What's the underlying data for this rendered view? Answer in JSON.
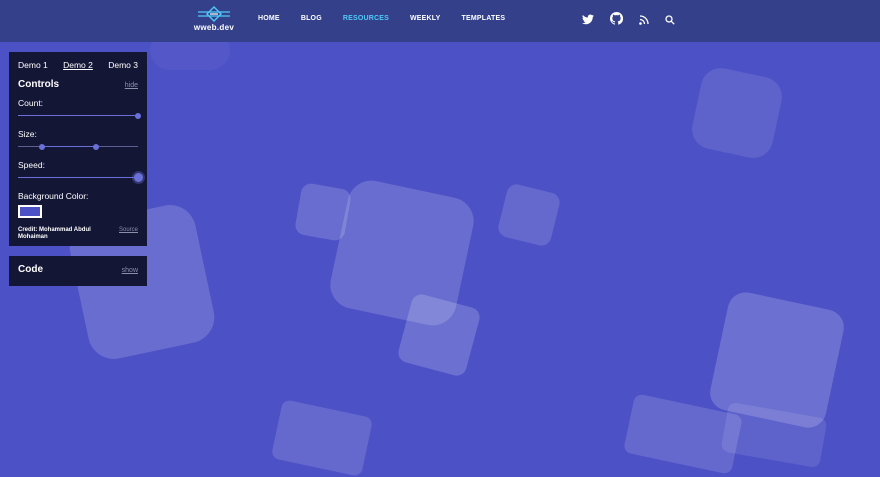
{
  "header": {
    "logo_text": "wweb.dev",
    "nav": [
      {
        "label": "HOME",
        "active": false
      },
      {
        "label": "BLOG",
        "active": false
      },
      {
        "label": "RESOURCES",
        "active": true
      },
      {
        "label": "WEEKLY",
        "active": false
      },
      {
        "label": "TEMPLATES",
        "active": false
      }
    ],
    "social_icons": [
      "twitter-icon",
      "github-icon",
      "rss-icon",
      "search-icon"
    ]
  },
  "controls_panel": {
    "tabs": [
      {
        "label": "Demo 1",
        "active": false
      },
      {
        "label": "Demo 2",
        "active": true
      },
      {
        "label": "Demo 3",
        "active": false
      }
    ],
    "title": "Controls",
    "toggle_label": "hide",
    "count_label": "Count:",
    "count_value_fraction": 1.0,
    "size_label": "Size:",
    "size_range_fraction": [
      0.2,
      0.65
    ],
    "speed_label": "Speed:",
    "speed_value_fraction": 1.0,
    "bg_color_label": "Background Color:",
    "bg_color": "#4c51c6",
    "credit": "Credit: Mohammad Abdul Mohaiman",
    "source_label": "Source"
  },
  "code_panel": {
    "title": "Code",
    "toggle_label": "show"
  },
  "colors": {
    "background": "#4c51c6",
    "topbar": "#34418a",
    "panel": "#141636",
    "accent": "#4ec9f7",
    "slider": "#6a70d8"
  }
}
